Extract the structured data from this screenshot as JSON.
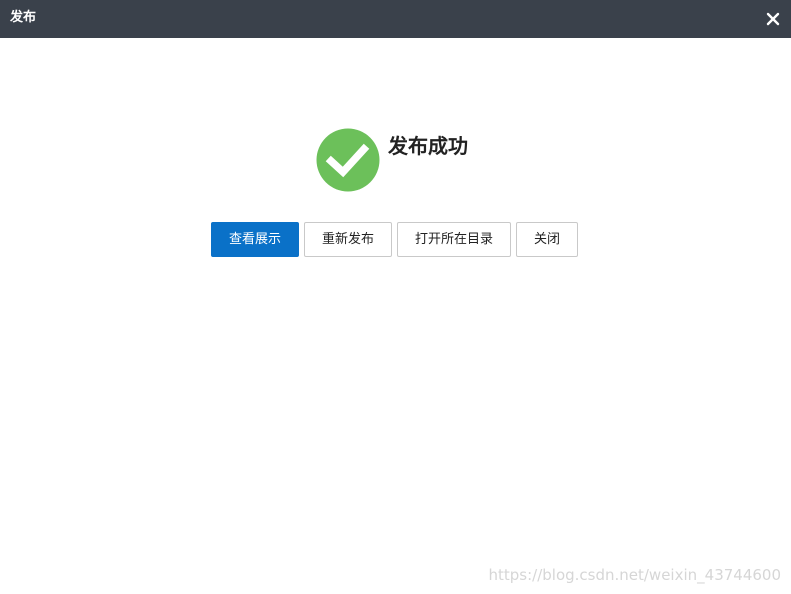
{
  "window": {
    "title": "发布"
  },
  "icons": {
    "close": "close-icon",
    "success": "check-circle-icon"
  },
  "status": {
    "text": "发布成功"
  },
  "actions": {
    "view_label": "查看展示",
    "republish_label": "重新发布",
    "open_dir_label": "打开所在目录",
    "close_label": "关闭"
  },
  "watermark": "https://blog.csdn.net/weixin_43744600",
  "colors": {
    "titlebar": "#3a414b",
    "primary": "#0a71c8",
    "success": "#6cc05a"
  }
}
